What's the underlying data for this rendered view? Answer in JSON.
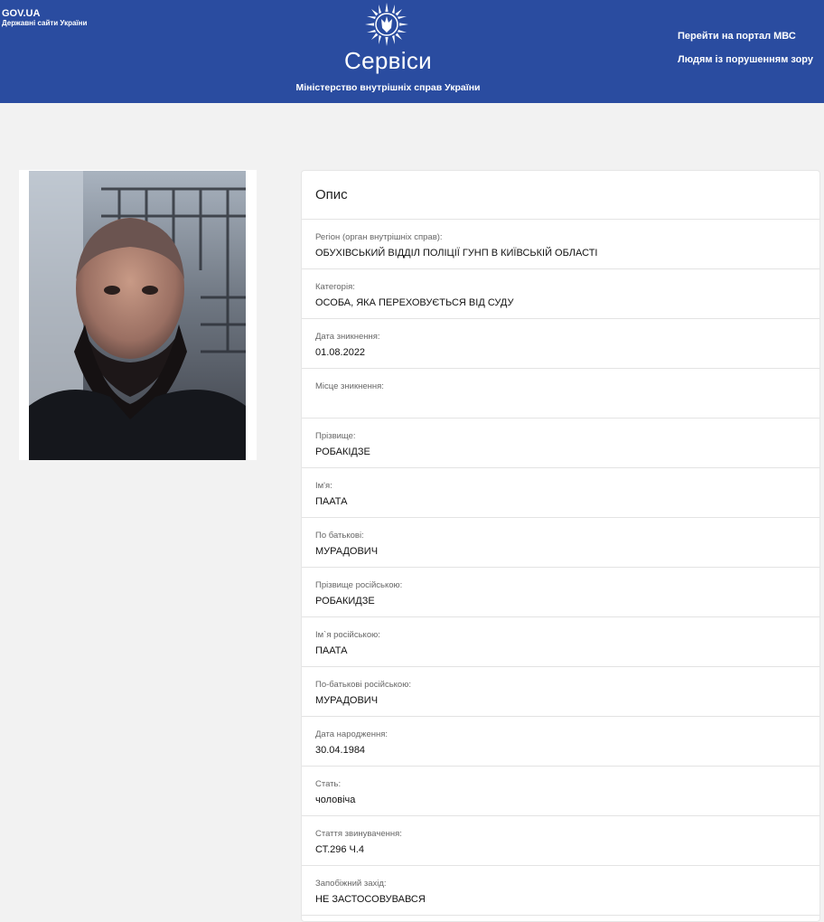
{
  "header": {
    "gov_title": "GOV.UA",
    "gov_subtitle": "Державні сайти України",
    "title": "Сервіси",
    "subtitle": "Міністерство внутрішніх справ України",
    "links": [
      "Перейти на портал МВС",
      "Людям із порушенням зору"
    ],
    "bg_color": "#2a4ca0"
  },
  "card": {
    "title": "Опис",
    "fields": [
      {
        "label": "Регіон (орган внутрішніх справ):",
        "value": "ОБУХІВСЬКИЙ ВІДДІЛ ПОЛІЦІЇ ГУНП В КИЇВСЬКІЙ ОБЛАСТІ"
      },
      {
        "label": "Категорія:",
        "value": "ОСОБА, ЯКА ПЕРЕХОВУЄТЬСЯ ВІД СУДУ"
      },
      {
        "label": "Дата зникнення:",
        "value": "01.08.2022"
      },
      {
        "label": "Місце зникнення:",
        "value": ""
      },
      {
        "label": "Прізвище:",
        "value": "РОБАКІДЗЕ"
      },
      {
        "label": "Ім'я:",
        "value": "ПААТА"
      },
      {
        "label": "По батькові:",
        "value": "МУРАДОВИЧ"
      },
      {
        "label": "Прізвище російською:",
        "value": "РОБАКИДЗЕ"
      },
      {
        "label": "Ім`я російською:",
        "value": "ПААТА"
      },
      {
        "label": "По-батькові російською:",
        "value": "МУРАДОВИЧ"
      },
      {
        "label": "Дата народження:",
        "value": "30.04.1984"
      },
      {
        "label": "Стать:",
        "value": "чоловіча"
      },
      {
        "label": "Стаття звинувачення:",
        "value": "СТ.296 Ч.4"
      },
      {
        "label": "Запобіжний захід:",
        "value": "НЕ ЗАСТОСОВУВАВСЯ"
      }
    ]
  }
}
